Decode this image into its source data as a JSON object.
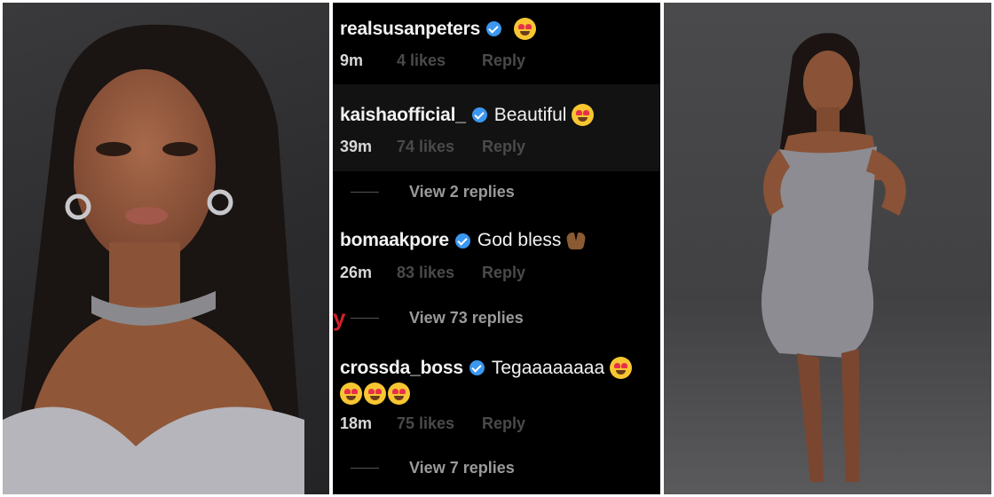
{
  "comments": [
    {
      "username": "realsusanpeters",
      "text": "",
      "emoji": "heart-eyes",
      "time": "9m",
      "likes": "4 likes",
      "reply": "Reply",
      "view_replies": ""
    },
    {
      "username": "kaishaofficial_",
      "text": "Beautiful",
      "emoji": "heart-eyes",
      "time": "39m",
      "likes": "74 likes",
      "reply": "Reply",
      "view_replies": "View 2 replies"
    },
    {
      "username": "bomaakpore",
      "text": "God bless",
      "emoji": "folded-hands",
      "time": "26m",
      "likes": "83 likes",
      "reply": "Reply",
      "view_replies": "View 73 replies"
    },
    {
      "username": "crossda_boss",
      "text": "Tegaaaaaaaa",
      "emoji": "heart-eyes",
      "extra_emojis": [
        "heart-eyes",
        "heart-eyes",
        "heart-eyes"
      ],
      "time": "18m",
      "likes": "75 likes",
      "reply": "Reply",
      "view_replies": "View 7 replies"
    }
  ],
  "colors": {
    "verified": "#3b97f0",
    "background": "#000000",
    "username": "#f2f2f2",
    "muted": "#4a4a4a"
  }
}
